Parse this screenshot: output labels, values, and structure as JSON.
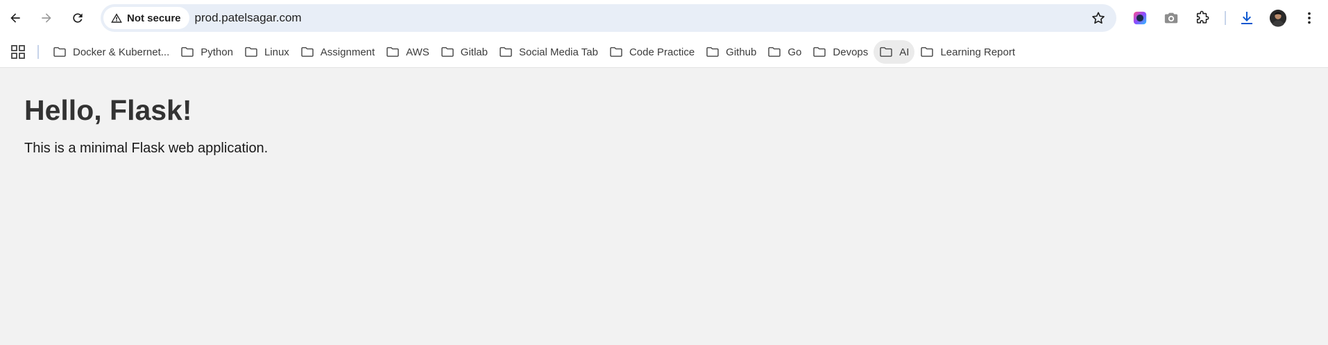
{
  "browser": {
    "security_label": "Not secure",
    "url": "prod.patelsagar.com",
    "icons": {
      "back": "arrow-left-icon",
      "forward": "arrow-right-icon",
      "reload": "reload-icon",
      "security": "warning-triangle-icon",
      "bookmark": "star-icon",
      "extensions": [
        "color-picker-extension-icon",
        "camera-extension-icon",
        "puzzle-icon",
        "download-icon",
        "profile-avatar",
        "kebab-menu-icon"
      ]
    },
    "accent_color": "#0b57d0"
  },
  "bookmarks": {
    "items": [
      {
        "label": "Docker & Kubernet..."
      },
      {
        "label": "Python"
      },
      {
        "label": "Linux"
      },
      {
        "label": "Assignment"
      },
      {
        "label": "AWS"
      },
      {
        "label": "Gitlab"
      },
      {
        "label": "Social Media Tab"
      },
      {
        "label": "Code Practice"
      },
      {
        "label": "Github"
      },
      {
        "label": "Go"
      },
      {
        "label": "Devops"
      },
      {
        "label": "AI"
      },
      {
        "label": "Learning Report"
      }
    ],
    "active_item": "AI"
  },
  "page": {
    "heading": "Hello, Flask!",
    "paragraph": "This is a minimal Flask web application."
  }
}
